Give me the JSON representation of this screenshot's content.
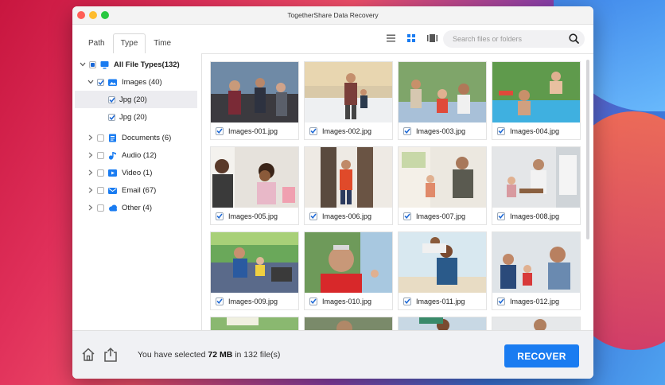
{
  "window": {
    "title": "TogetherShare Data Recovery"
  },
  "tabs": [
    {
      "label": "Path",
      "active": false
    },
    {
      "label": "Type",
      "active": true
    },
    {
      "label": "Time",
      "active": false
    }
  ],
  "search": {
    "placeholder": "Search files or folders"
  },
  "tree": {
    "all": "All File Types(132)",
    "images": "Images (40)",
    "jpg1": "Jpg (20)",
    "jpg2": "Jpg (20)",
    "documents": "Documents (6)",
    "audio": "Audio (12)",
    "video": "Video (1)",
    "email": "Email (67)",
    "other": "Other (4)"
  },
  "files": [
    "Images-001.jpg",
    "Images-002.jpg",
    "Images-003.jpg",
    "Images-004.jpg",
    "Images-005.jpg",
    "Images-006.jpg",
    "Images-007.jpg",
    "Images-008.jpg",
    "Images-009.jpg",
    "Images-010.jpg",
    "Images-011.jpg",
    "Images-012.jpg"
  ],
  "footer": {
    "status_prefix": "You have selected",
    "size": "72 MB",
    "status_suffix": "in 132 file(s)",
    "recover_label": "RECOVER"
  },
  "colors": {
    "accent": "#1a7cf1",
    "check": "#1a67d6"
  },
  "icons": {
    "all": "monitor-icon",
    "images": "image-folder-icon",
    "documents": "document-icon",
    "audio": "music-note-icon",
    "video": "video-icon",
    "email": "envelope-icon",
    "other": "cloud-icon"
  }
}
